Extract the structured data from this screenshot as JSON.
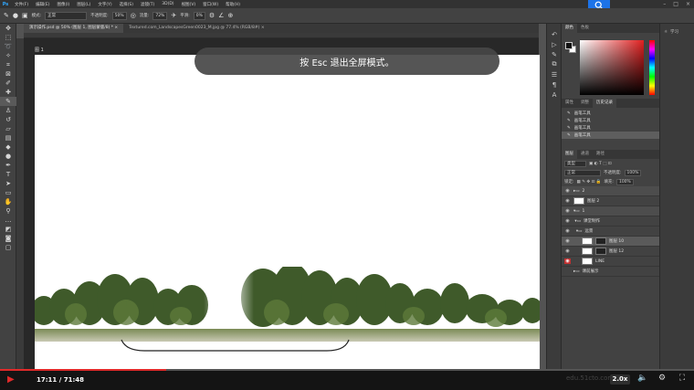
{
  "menu": {
    "logo": "Ps",
    "items": [
      "文件(F)",
      "编辑(E)",
      "图像(I)",
      "图层(L)",
      "文字(Y)",
      "选择(S)",
      "滤镜(T)",
      "3D(D)",
      "视图(V)",
      "窗口(W)",
      "帮助(H)"
    ]
  },
  "options": {
    "mode_label": "模式:",
    "mode_value": "正常",
    "opacity_label": "不透明度:",
    "opacity_value": "50%",
    "flow_label": "流量:",
    "flow_value": "72%",
    "smooth_label": "平滑:",
    "smooth_value": "0%"
  },
  "tabs": [
    {
      "label": "演示操作.psd @ 50% (图层 1, 图层蒙版/8) * ×",
      "active": true
    },
    {
      "label": "Textured.com_LandscapesGreen0023_M.jpg @ 77.4% (RGB/8#) ×",
      "active": false
    }
  ],
  "canvas": {
    "doc_label": "图 1",
    "esc_message": "按 Esc 退出全屏模式。"
  },
  "panels": {
    "color_tabs": [
      "颜色",
      "色板"
    ],
    "history_tabs": [
      "属性",
      "调整",
      "历史记录"
    ],
    "history_items": [
      "画笔工具",
      "画笔工具",
      "画笔工具",
      "画笔工具"
    ],
    "layers_tabs": [
      "图层",
      "通道",
      "路径"
    ],
    "filter_label": "类型",
    "blend_mode": "正常",
    "opacity_label": "不透明度:",
    "opacity_value": "100%",
    "lock_label": "锁定:",
    "fill_label": "填充:",
    "fill_value": "100%",
    "layers": [
      {
        "name": "2",
        "type": "group"
      },
      {
        "name": "图层 2",
        "type": "layer"
      },
      {
        "name": "1",
        "type": "group"
      },
      {
        "name": "课堂制作",
        "type": "folder"
      },
      {
        "name": "远景",
        "type": "folder"
      },
      {
        "name": "图层 10",
        "type": "layer"
      },
      {
        "name": "图层 12",
        "type": "layer"
      },
      {
        "name": "LINE",
        "type": "layer"
      },
      {
        "name": "课前展示",
        "type": "folder"
      }
    ]
  },
  "farcol": {
    "learn_label": "学习"
  },
  "video": {
    "time": "17:11 / 71:48",
    "speed": "2.0x",
    "progress": 0.239,
    "watermark": "edu.51cto.com"
  },
  "colors": {
    "accent_red": "#e02a2a",
    "ps_blue": "#31a8ff"
  }
}
